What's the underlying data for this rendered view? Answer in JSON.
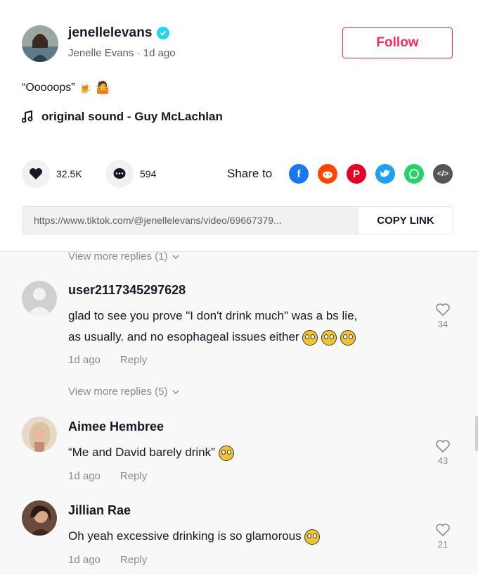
{
  "post": {
    "username": "jenellelevans",
    "display_name": "Jenelle Evans",
    "time_ago": "1d ago",
    "follow_label": "Follow",
    "caption": "“Ooooops”",
    "sound": "original sound - Guy McLachlan",
    "likes": "32.5K",
    "comments": "594",
    "share_label": "Share to",
    "link": "https://www.tiktok.com/@jenellelevans/video/69667379...",
    "copy_label": "COPY LINK"
  },
  "share_icons": [
    {
      "name": "facebook-icon",
      "color": "#1877F2"
    },
    {
      "name": "reddit-icon",
      "color": "#FF4500"
    },
    {
      "name": "pinterest-icon",
      "color": "#E60023"
    },
    {
      "name": "twitter-icon",
      "color": "#1DA1F2"
    },
    {
      "name": "whatsapp-icon",
      "color": "#25D366"
    },
    {
      "name": "embed-icon",
      "color": "#555555"
    }
  ],
  "comments": {
    "view_more_top": "View more replies (1)",
    "view_more_mid": "View more replies (5)",
    "items": [
      {
        "user": "user2117345297628",
        "text_line1": "glad to see you prove \"I don't drink much\" was a bs lie,",
        "text_line2": "as usually. and no esophageal issues either",
        "time": "1d ago",
        "reply": "Reply",
        "likes": "34"
      },
      {
        "user": "Aimee Hembree",
        "text": "“Me and David barely drink”",
        "time": "1d ago",
        "reply": "Reply",
        "likes": "43"
      },
      {
        "user": "Jillian Rae",
        "text": "Oh yeah excessive drinking is so glamorous",
        "time": "1d ago",
        "reply": "Reply",
        "likes": "21"
      }
    ]
  }
}
